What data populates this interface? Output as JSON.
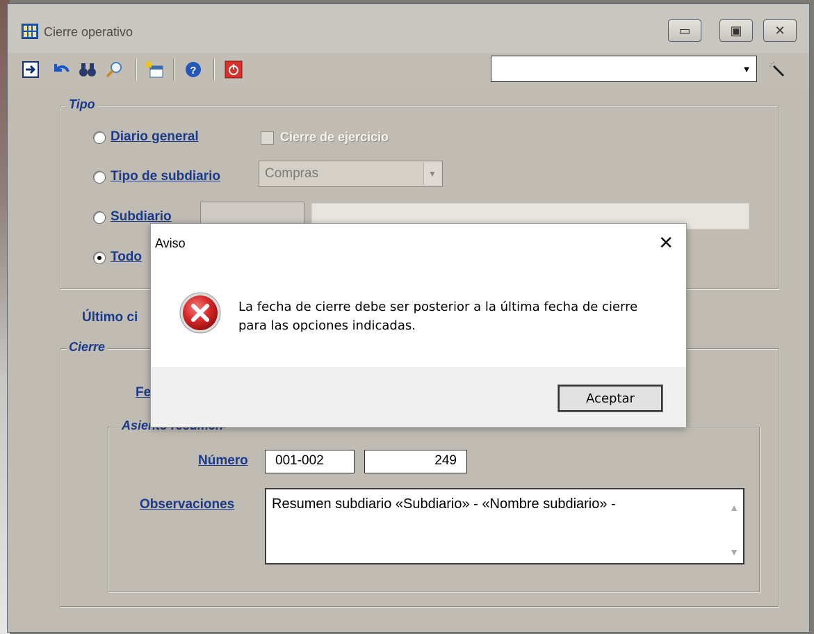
{
  "window": {
    "title": "Cierre operativo",
    "minimize_glyph": "▭",
    "maximize_glyph": "▣",
    "close_glyph": "✕"
  },
  "toolbar": {
    "icons": [
      "arrow-right-icon",
      "undo-icon",
      "binoculars-icon",
      "magnifier-icon",
      "new-document-icon",
      "help-icon",
      "power-icon"
    ],
    "combo_value": "",
    "combo_arrow": "▼"
  },
  "tipo": {
    "legend": "Tipo",
    "diario_general": "Diario general",
    "cierre_ejercicio": "Cierre de ejercicio",
    "tipo_subdiario": "Tipo de subdiario",
    "tipo_subdiario_value": "Compras",
    "subdiario": "Subdiario",
    "todos": "Todo",
    "selected": "todos"
  },
  "ultimo": {
    "label": "Último ci"
  },
  "cierre": {
    "legend": "Cierre",
    "fecha_partial": "Fe",
    "asiento_legend": "Asiento resumen",
    "numero_label": "Número",
    "numero_prefix": "001-002",
    "numero_value": "249",
    "observaciones_label": "Observaciones",
    "observaciones_value": "Resumen subdiario «Subdiario» - «Nombre subdiario» -"
  },
  "dialog": {
    "title": "Aviso",
    "close_glyph": "✕",
    "message": "La fecha de cierre debe ser posterior a la última fecha de cierre para las opciones indicadas.",
    "button": "Aceptar",
    "icon": "error-icon"
  },
  "colors": {
    "accent": "#1a3a8a",
    "error": "#d62b2b",
    "window_bg": "#c0bcb4"
  }
}
